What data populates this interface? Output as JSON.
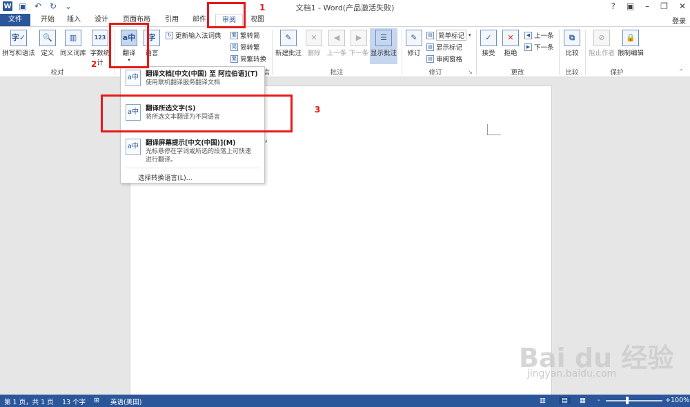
{
  "title_bar": {
    "app_badge": "W",
    "title": "文档1 - Word(产品激活失败)",
    "help": "?",
    "login": "登录"
  },
  "tabs": [
    {
      "label": "文件"
    },
    {
      "label": "开始"
    },
    {
      "label": "插入"
    },
    {
      "label": "设计"
    },
    {
      "label": "页面布局"
    },
    {
      "label": "引用"
    },
    {
      "label": "邮件"
    },
    {
      "label": "审阅"
    },
    {
      "label": "视图"
    }
  ],
  "ribbon": {
    "spelling": "拼写和语法",
    "define": "定义",
    "thesaurus": "同义词库",
    "word_count": "字数统计",
    "translate": "翻译",
    "language": "语言",
    "update_ime": "更新输入法词典",
    "trad_to_simp": "繁转简",
    "simp_to_trad": "简转繁",
    "convert": "简繁转换",
    "new_comment": "新建批注",
    "delete": "删除",
    "prev_comment": "上一条",
    "next_comment": "下一条",
    "show_comments": "显示批注",
    "track_changes": "修订",
    "markup_mode": "简单标记",
    "show_markup": "显示标记",
    "review_pane": "审阅窗格",
    "accept": "接受",
    "reject": "拒绝",
    "prev_change": "上一条",
    "next_change": "下一条",
    "compare": "比较",
    "block_authors": "阻止作者",
    "restrict_editing": "限制编辑",
    "groups": {
      "proofing": "校对",
      "language_group": "语言",
      "comments": "批注",
      "tracking": "修订",
      "changes": "更改",
      "compare": "比较",
      "protect": "保护"
    }
  },
  "translate_menu": {
    "item1_title": "翻译文档[中文(中国) 至 阿拉伯语](T)",
    "item1_desc": "使用联机翻译服务翻译文档",
    "item2_title": "翻译所选文字(S)",
    "item2_desc": "将所选文本翻译为不同语言",
    "item3_title": "翻译屏幕提示[中文(中国)](M)",
    "item3_desc": "光标悬停在字词或所选的段落上可快速进行翻译。",
    "footer": "选择转换语言(L)..."
  },
  "annotations": {
    "n1": "1",
    "n2": "2",
    "n3": "3",
    "color": "#e81818"
  },
  "status_bar": {
    "page": "第 1 页，共 1 页",
    "words": "13 个字",
    "language": "英语(美国)",
    "zoom": "100%",
    "zoom_minus": "-",
    "zoom_plus": "+"
  },
  "watermark": {
    "brand": "Bai du 经验",
    "url": "jingyan.baidu.com"
  },
  "colors": {
    "brand_blue": "#2b579a",
    "highlight": "#c5d6ee"
  }
}
